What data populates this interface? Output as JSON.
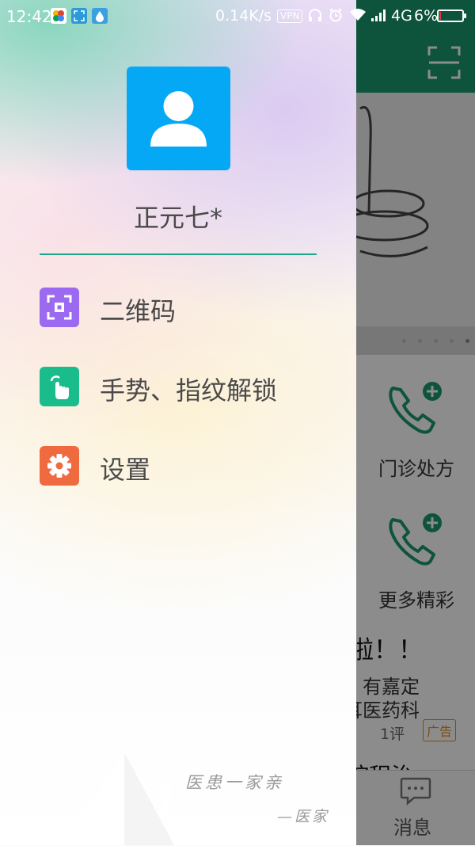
{
  "status_bar": {
    "time": "12:42",
    "net_speed": "0.14K/s",
    "vpn_label": "VPN",
    "network_type": "4G",
    "battery_percent": "6%",
    "battery_level": 0.06
  },
  "drawer": {
    "user_name": "正元七*",
    "menu": [
      {
        "label": "二维码",
        "icon": "qr-scan-icon",
        "color": "#9b6af0"
      },
      {
        "label": "手势、指纹解锁",
        "icon": "gesture-touch-icon",
        "color": "#1bbc8c"
      },
      {
        "label": "设置",
        "icon": "gear-icon",
        "color": "#f06a40"
      }
    ],
    "slogan_line1": "医患一家亲",
    "slogan_line2": "—医家"
  },
  "background_app": {
    "header_color": "#1a9a6d",
    "tile1_label": "门诊处方",
    "tile2_label": "更多精彩",
    "article_title": "钱啦！！",
    "article_line1": "发，有嘉定",
    "article_line2": "洛耳医药科",
    "comments": "1评",
    "ad_badge": "广告",
    "next_article_title": "术院程治",
    "tab_message_label": "消息"
  }
}
